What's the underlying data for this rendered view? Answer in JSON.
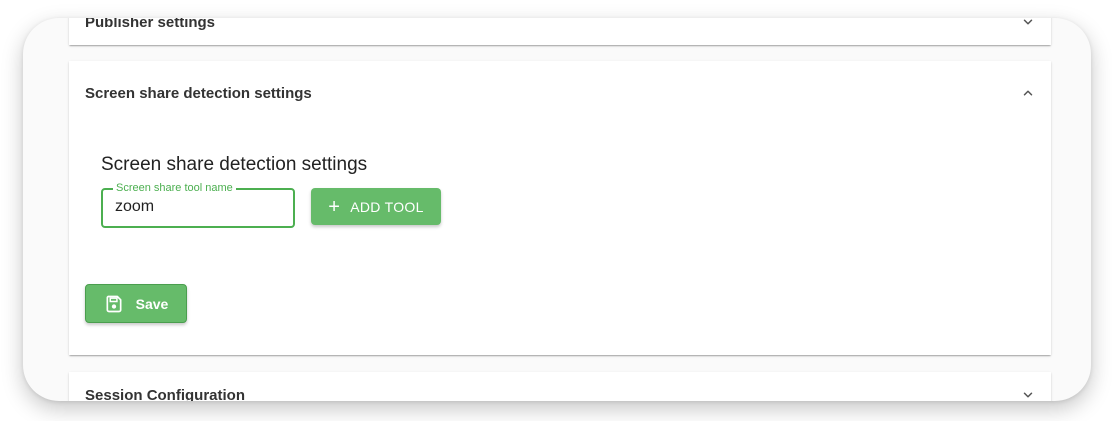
{
  "panels": {
    "publisher": {
      "title": "Publisher settings",
      "expanded": false
    },
    "screen_share": {
      "title": "Screen share detection settings",
      "expanded": true,
      "heading": "Screen share detection settings",
      "tool_field": {
        "label": "Screen share tool name",
        "value": "zoom"
      },
      "add_tool_label": "ADD TOOL",
      "save_label": "Save"
    },
    "session": {
      "title": "Session Configuration",
      "expanded": false
    }
  },
  "colors": {
    "accent": "#4caf50",
    "button": "#66bb6a",
    "text_dark": "#333333"
  },
  "icons": {
    "publisher_toggle": "chevron-down-icon",
    "screen_share_toggle": "chevron-up-icon",
    "session_toggle": "chevron-down-icon",
    "add": "plus-icon",
    "save": "floppy-disk-icon"
  }
}
